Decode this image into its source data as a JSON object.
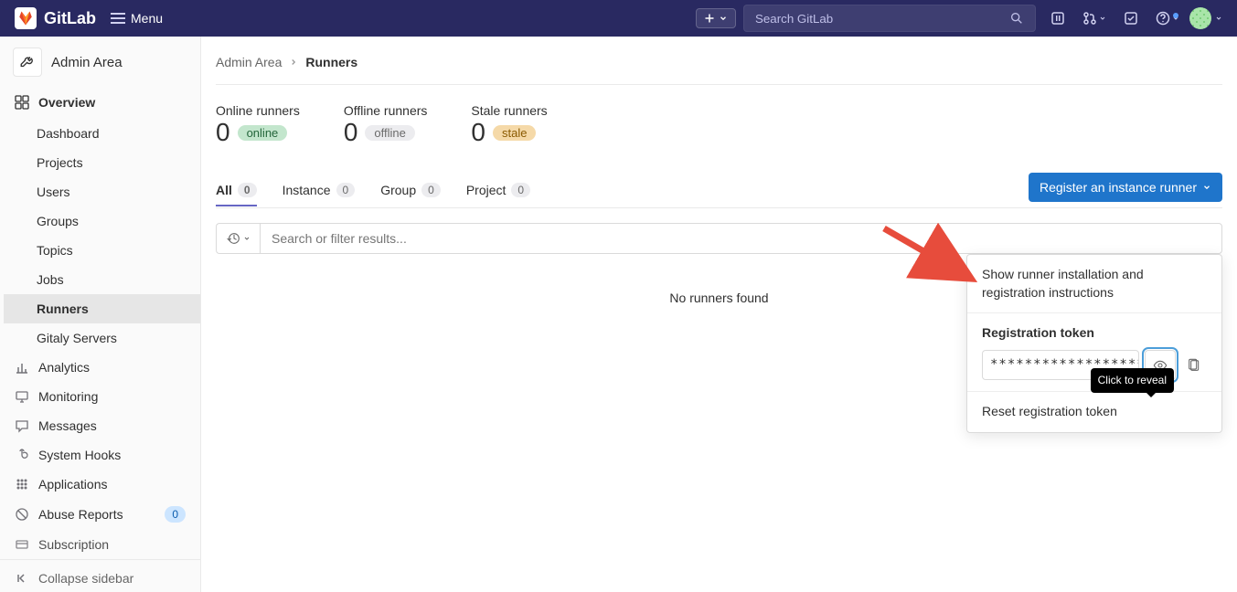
{
  "brand": "GitLab",
  "menu_label": "Menu",
  "search_placeholder": "Search GitLab",
  "sidebar": {
    "area_title": "Admin Area",
    "section": "Overview",
    "items": [
      {
        "label": "Dashboard"
      },
      {
        "label": "Projects"
      },
      {
        "label": "Users"
      },
      {
        "label": "Groups"
      },
      {
        "label": "Topics"
      },
      {
        "label": "Jobs"
      },
      {
        "label": "Runners"
      },
      {
        "label": "Gitaly Servers"
      }
    ],
    "extra": [
      {
        "label": "Analytics"
      },
      {
        "label": "Monitoring"
      },
      {
        "label": "Messages"
      },
      {
        "label": "System Hooks"
      },
      {
        "label": "Applications"
      },
      {
        "label": "Abuse Reports",
        "badge": "0"
      },
      {
        "label": "Subscription"
      }
    ],
    "collapse": "Collapse sidebar"
  },
  "breadcrumb": {
    "root": "Admin Area",
    "current": "Runners"
  },
  "stats": {
    "online": {
      "label": "Online runners",
      "count": "0",
      "chip": "online"
    },
    "offline": {
      "label": "Offline runners",
      "count": "0",
      "chip": "offline"
    },
    "stale": {
      "label": "Stale runners",
      "count": "0",
      "chip": "stale"
    }
  },
  "tabs": {
    "all": {
      "label": "All",
      "count": "0"
    },
    "instance": {
      "label": "Instance",
      "count": "0"
    },
    "group": {
      "label": "Group",
      "count": "0"
    },
    "project": {
      "label": "Project",
      "count": "0"
    }
  },
  "register_btn": "Register an instance runner",
  "filter_placeholder": "Search or filter results...",
  "empty_text": "No runners found",
  "dropdown": {
    "instructions": "Show runner installation and registration instructions",
    "token_label": "Registration token",
    "token_value": "********************",
    "tooltip": "Click to reveal",
    "reset": "Reset registration token"
  }
}
